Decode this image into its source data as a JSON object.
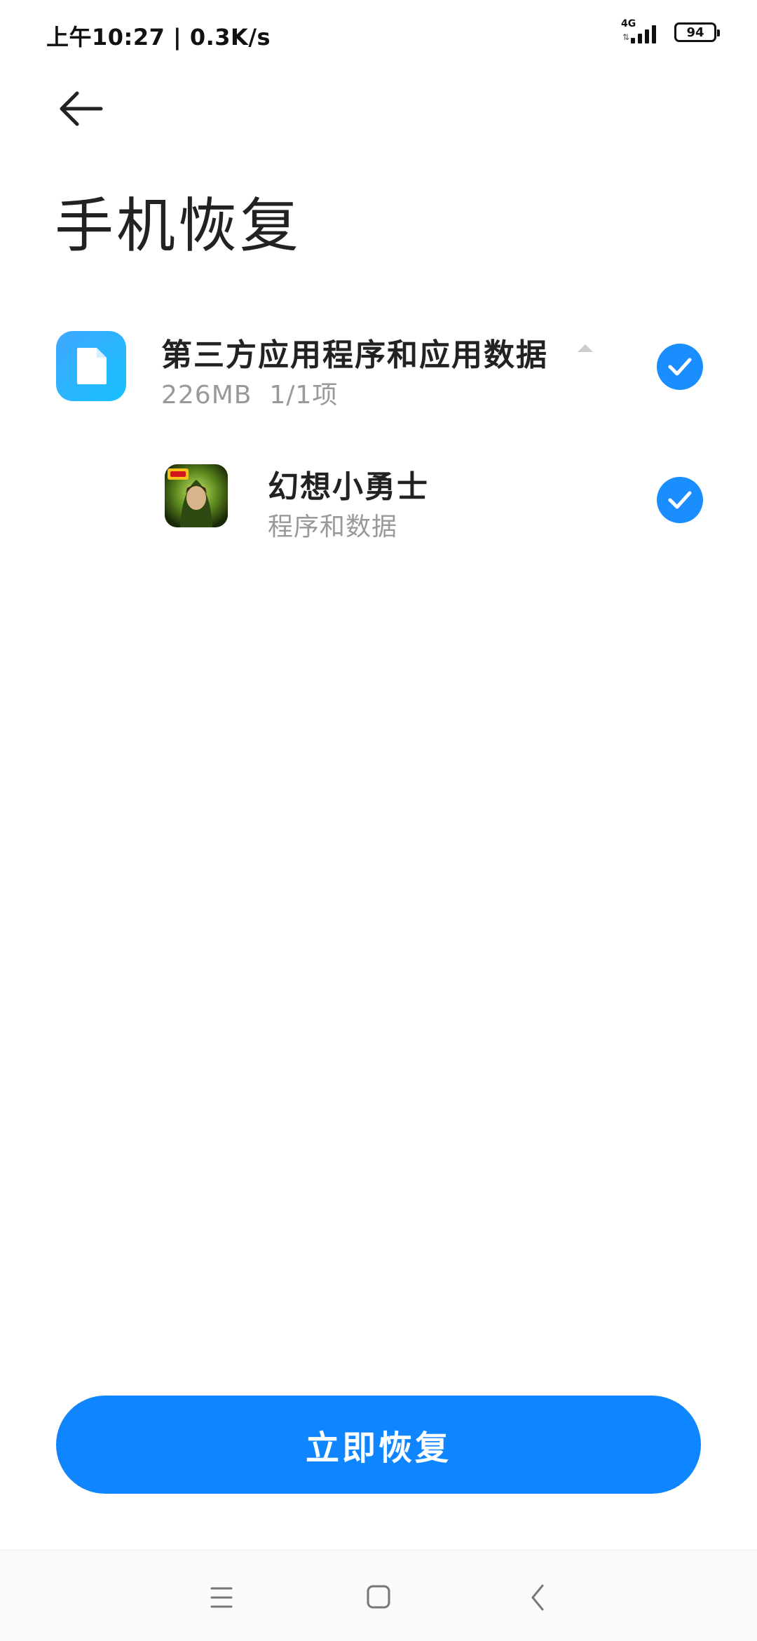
{
  "status_bar": {
    "time_speed": "上午10:27 | 0.3K/s",
    "network_type": "4G",
    "battery_level": "94"
  },
  "header": {
    "title": "手机恢复"
  },
  "category": {
    "title": "第三方应用程序和应用数据",
    "size": "226MB",
    "count": "1/1项",
    "checked": true
  },
  "app": {
    "name": "幻想小勇士",
    "description": "程序和数据",
    "checked": true
  },
  "actions": {
    "restore_label": "立即恢复"
  },
  "colors": {
    "accent": "#0f86ff",
    "check": "#1a8dff",
    "category_icon": "#2bb4ff"
  },
  "icons": {
    "back": "arrow-left-icon",
    "category": "file-icon",
    "expand": "triangle-up-icon",
    "check": "check-icon",
    "nav_menu": "menu-icon",
    "nav_home": "square-icon",
    "nav_back": "chevron-left-icon"
  }
}
